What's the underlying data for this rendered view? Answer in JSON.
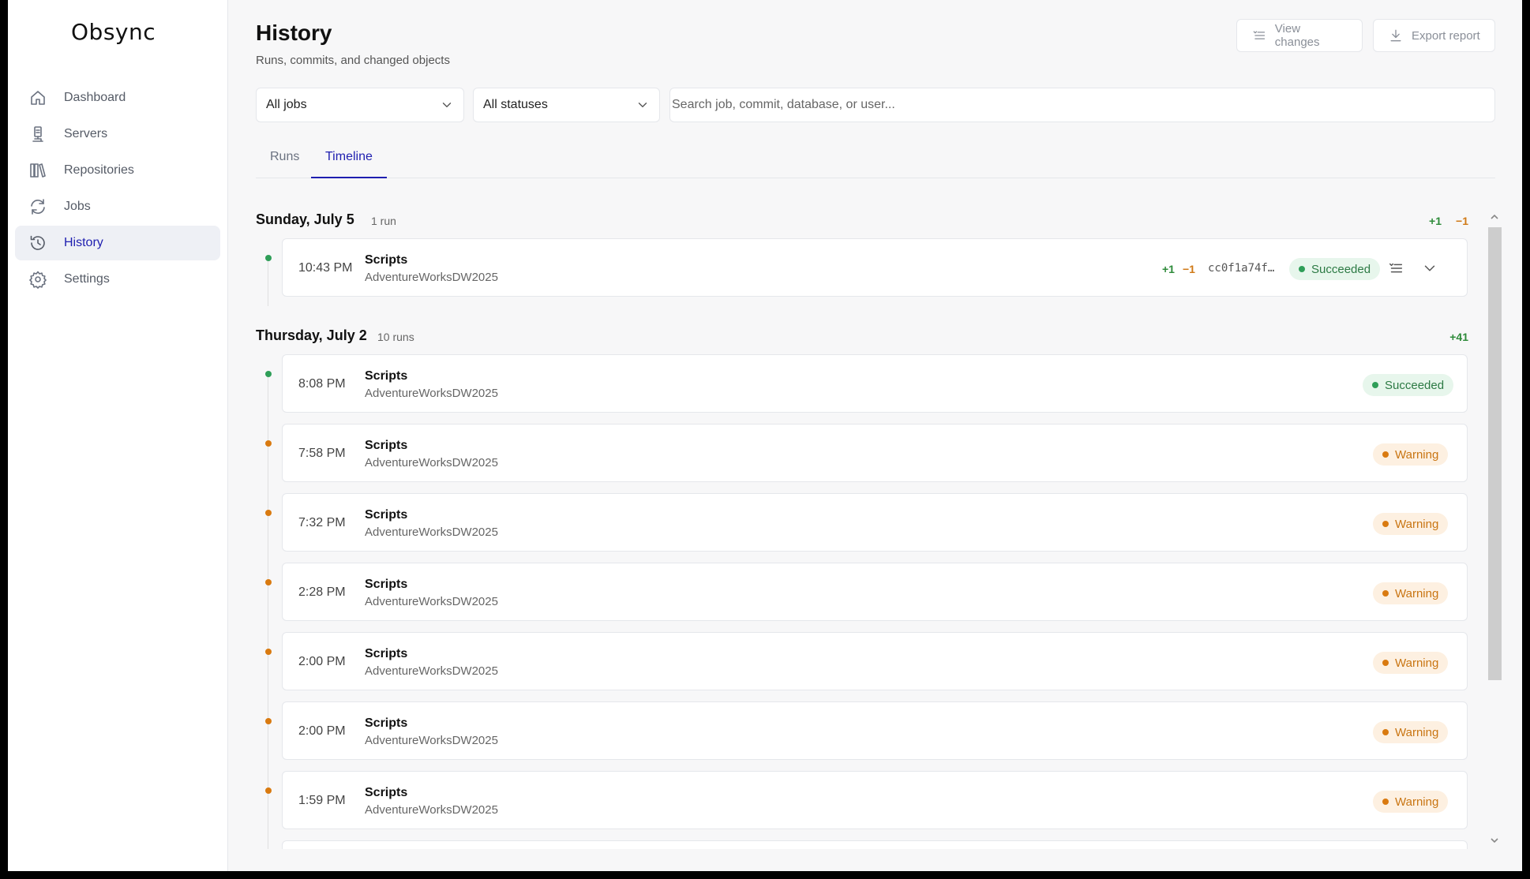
{
  "app": {
    "name": "Obsync"
  },
  "sidebar": {
    "items": [
      {
        "label": "Dashboard",
        "icon": "home-icon"
      },
      {
        "label": "Servers",
        "icon": "server-icon"
      },
      {
        "label": "Repositories",
        "icon": "books-icon"
      },
      {
        "label": "Jobs",
        "icon": "refresh-icon"
      },
      {
        "label": "History",
        "icon": "history-icon",
        "active": true
      },
      {
        "label": "Settings",
        "icon": "gear-icon"
      }
    ]
  },
  "header": {
    "title": "History",
    "subtitle": "Runs, commits, and changed objects",
    "view_changes_label": "View changes",
    "export_report_label": "Export report"
  },
  "filters": {
    "jobs_value": "All jobs",
    "status_value": "All statuses",
    "search_placeholder": "Search job, commit, database, or user..."
  },
  "tabs": {
    "runs_label": "Runs",
    "timeline_label": "Timeline",
    "active": "Timeline"
  },
  "timeline": {
    "groups": [
      {
        "date": "Sunday, July 5",
        "count": "1 run",
        "plus": "+1",
        "minus": "−1",
        "runs": [
          {
            "time": "10:43 PM",
            "name": "Scripts",
            "database": "AdventureWorksDW2025",
            "status": "Succeeded",
            "plus": "+1",
            "minus": "−1",
            "commit": "cc0f1a74f…"
          }
        ]
      },
      {
        "date": "Thursday, July 2",
        "count": "10 runs",
        "plus": "+41",
        "runs": [
          {
            "time": "8:08 PM",
            "name": "Scripts",
            "database": "AdventureWorksDW2025",
            "status": "Succeeded"
          },
          {
            "time": "7:58 PM",
            "name": "Scripts",
            "database": "AdventureWorksDW2025",
            "status": "Warning"
          },
          {
            "time": "7:32 PM",
            "name": "Scripts",
            "database": "AdventureWorksDW2025",
            "status": "Warning"
          },
          {
            "time": "2:28 PM",
            "name": "Scripts",
            "database": "AdventureWorksDW2025",
            "status": "Warning"
          },
          {
            "time": "2:00 PM",
            "name": "Scripts",
            "database": "AdventureWorksDW2025",
            "status": "Warning"
          },
          {
            "time": "2:00 PM",
            "name": "Scripts",
            "database": "AdventureWorksDW2025",
            "status": "Warning"
          },
          {
            "time": "1:59 PM",
            "name": "Scripts",
            "database": "AdventureWorksDW2025",
            "status": "Warning"
          }
        ]
      }
    ]
  },
  "colors": {
    "accent": "#1f1fb0",
    "success": "#2f9e58",
    "warning": "#d97a10"
  }
}
